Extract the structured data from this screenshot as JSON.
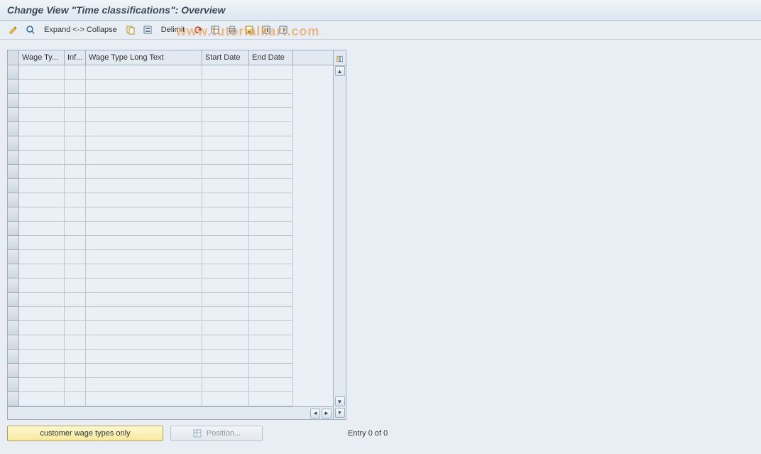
{
  "title": "Change View \"Time classifications\": Overview",
  "toolbar": {
    "expand_collapse_label": "Expand <-> Collapse",
    "delimit_label": "Delimit"
  },
  "table": {
    "columns": {
      "wage_type": "Wage Ty...",
      "inf": "Inf...",
      "wage_type_long": "Wage Type Long Text",
      "start_date": "Start Date",
      "end_date": "End Date"
    },
    "rows": [
      {
        "wage_type": "",
        "inf": "",
        "long": "",
        "start": "",
        "end": ""
      },
      {
        "wage_type": "",
        "inf": "",
        "long": "",
        "start": "",
        "end": ""
      },
      {
        "wage_type": "",
        "inf": "",
        "long": "",
        "start": "",
        "end": ""
      },
      {
        "wage_type": "",
        "inf": "",
        "long": "",
        "start": "",
        "end": ""
      },
      {
        "wage_type": "",
        "inf": "",
        "long": "",
        "start": "",
        "end": ""
      },
      {
        "wage_type": "",
        "inf": "",
        "long": "",
        "start": "",
        "end": ""
      },
      {
        "wage_type": "",
        "inf": "",
        "long": "",
        "start": "",
        "end": ""
      },
      {
        "wage_type": "",
        "inf": "",
        "long": "",
        "start": "",
        "end": ""
      },
      {
        "wage_type": "",
        "inf": "",
        "long": "",
        "start": "",
        "end": ""
      },
      {
        "wage_type": "",
        "inf": "",
        "long": "",
        "start": "",
        "end": ""
      },
      {
        "wage_type": "",
        "inf": "",
        "long": "",
        "start": "",
        "end": ""
      },
      {
        "wage_type": "",
        "inf": "",
        "long": "",
        "start": "",
        "end": ""
      },
      {
        "wage_type": "",
        "inf": "",
        "long": "",
        "start": "",
        "end": ""
      },
      {
        "wage_type": "",
        "inf": "",
        "long": "",
        "start": "",
        "end": ""
      },
      {
        "wage_type": "",
        "inf": "",
        "long": "",
        "start": "",
        "end": ""
      },
      {
        "wage_type": "",
        "inf": "",
        "long": "",
        "start": "",
        "end": ""
      },
      {
        "wage_type": "",
        "inf": "",
        "long": "",
        "start": "",
        "end": ""
      },
      {
        "wage_type": "",
        "inf": "",
        "long": "",
        "start": "",
        "end": ""
      },
      {
        "wage_type": "",
        "inf": "",
        "long": "",
        "start": "",
        "end": ""
      },
      {
        "wage_type": "",
        "inf": "",
        "long": "",
        "start": "",
        "end": ""
      },
      {
        "wage_type": "",
        "inf": "",
        "long": "",
        "start": "",
        "end": ""
      },
      {
        "wage_type": "",
        "inf": "",
        "long": "",
        "start": "",
        "end": ""
      },
      {
        "wage_type": "",
        "inf": "",
        "long": "",
        "start": "",
        "end": ""
      },
      {
        "wage_type": "",
        "inf": "",
        "long": "",
        "start": "",
        "end": ""
      }
    ]
  },
  "footer": {
    "customer_button": "customer wage types only",
    "position_button": "Position...",
    "entry_text": "Entry 0 of 0"
  },
  "watermark": "www.tutorialkart.com"
}
